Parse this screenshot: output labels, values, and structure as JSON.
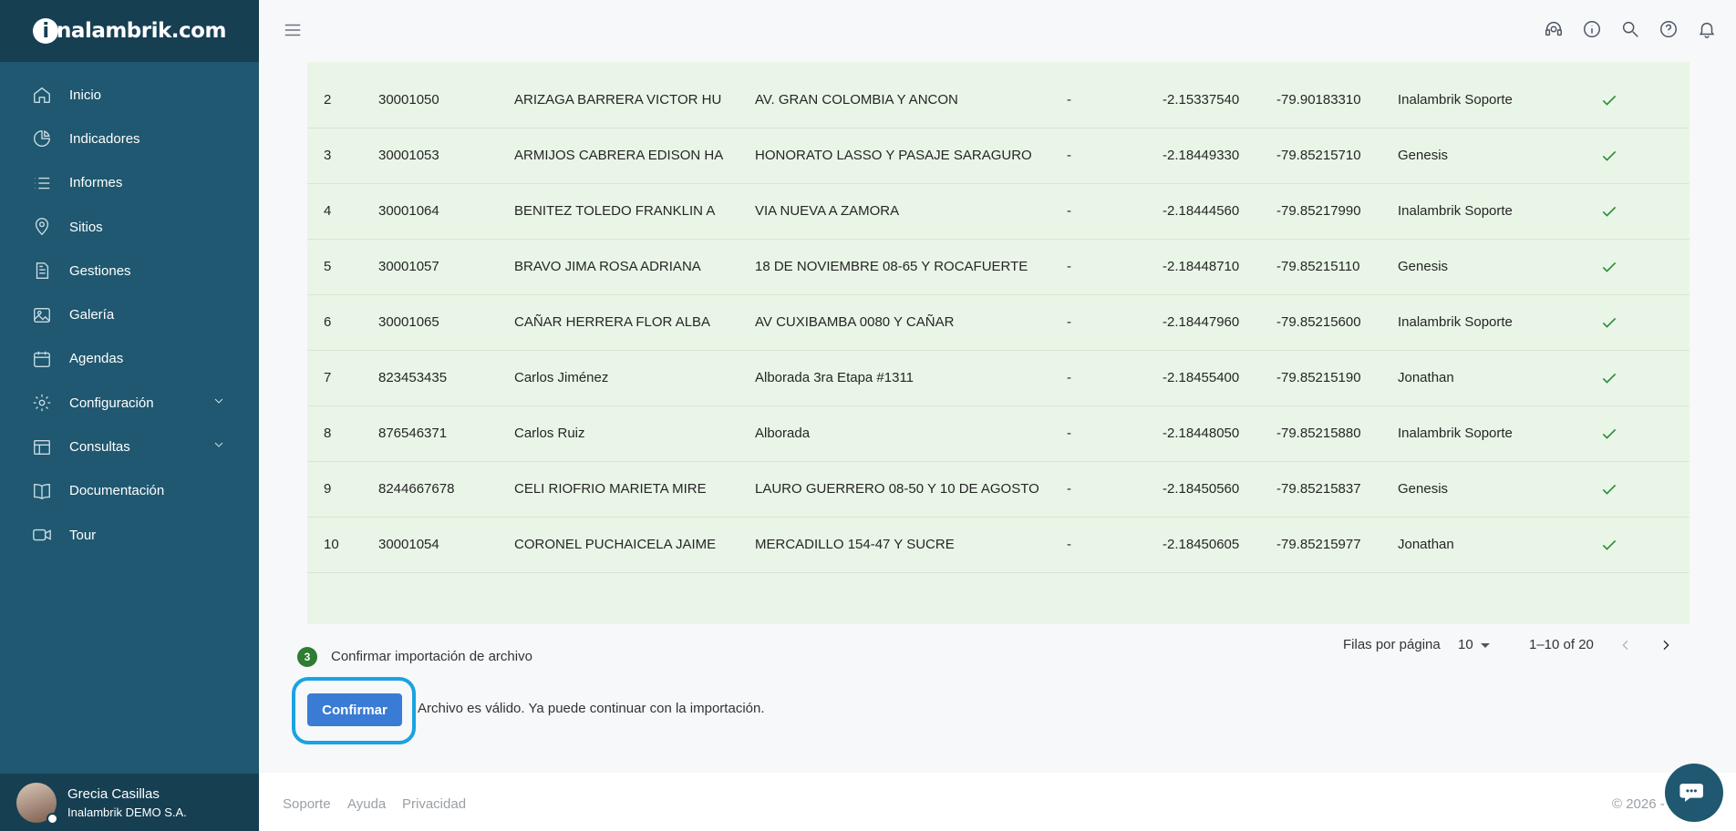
{
  "app": {
    "logo_text": "nalambrik.com",
    "logo_i": "i"
  },
  "sidebar": {
    "items": [
      {
        "label": "Inicio",
        "icon": "home-icon"
      },
      {
        "label": "Indicadores",
        "icon": "pie-chart-icon"
      },
      {
        "label": "Informes",
        "icon": "list-icon"
      },
      {
        "label": "Sitios",
        "icon": "map-pin-icon"
      },
      {
        "label": "Gestiones",
        "icon": "document-icon"
      },
      {
        "label": "Galería",
        "icon": "image-icon"
      },
      {
        "label": "Agendas",
        "icon": "calendar-icon"
      },
      {
        "label": "Configuración",
        "icon": "gear-icon",
        "chevron": true
      },
      {
        "label": "Consultas",
        "icon": "table-icon",
        "chevron": true
      },
      {
        "label": "Documentación",
        "icon": "book-icon"
      },
      {
        "label": "Tour",
        "icon": "video-icon"
      }
    ],
    "user": {
      "name": "Grecia Casillas",
      "company": "Inalambrik DEMO S.A."
    }
  },
  "topbar": {
    "icons": [
      "support-icon",
      "info-icon",
      "search-icon",
      "help-icon",
      "bell-icon"
    ]
  },
  "table": {
    "rows": [
      {
        "n": "2",
        "code": "30001050",
        "name": "ARIZAGA BARRERA VICTOR HU",
        "address": "AV. GRAN COLOMBIA Y ANCON",
        "ref": "-",
        "lat": "-2.15337540",
        "lon": "-79.90183310",
        "user": "Inalambrik Soporte"
      },
      {
        "n": "3",
        "code": "30001053",
        "name": "ARMIJOS CABRERA EDISON HA",
        "address": "HONORATO LASSO Y PASAJE SARAGURO",
        "ref": "-",
        "lat": "-2.18449330",
        "lon": "-79.85215710",
        "user": "Genesis"
      },
      {
        "n": "4",
        "code": "30001064",
        "name": "BENITEZ TOLEDO FRANKLIN A",
        "address": "VIA NUEVA A ZAMORA",
        "ref": "-",
        "lat": "-2.18444560",
        "lon": "-79.85217990",
        "user": "Inalambrik Soporte"
      },
      {
        "n": "5",
        "code": "30001057",
        "name": "BRAVO JIMA ROSA ADRIANA",
        "address": "18 DE NOVIEMBRE 08-65 Y ROCAFUERTE",
        "ref": "-",
        "lat": "-2.18448710",
        "lon": "-79.85215110",
        "user": "Genesis"
      },
      {
        "n": "6",
        "code": "30001065",
        "name": "CAÑAR HERRERA FLOR ALBA",
        "address": "AV CUXIBAMBA 0080 Y CAÑAR",
        "ref": "-",
        "lat": "-2.18447960",
        "lon": "-79.85215600",
        "user": "Inalambrik Soporte"
      },
      {
        "n": "7",
        "code": "823453435",
        "name": "Carlos Jiménez",
        "address": "Alborada 3ra Etapa #1311",
        "ref": "-",
        "lat": "-2.18455400",
        "lon": "-79.85215190",
        "user": "Jonathan"
      },
      {
        "n": "8",
        "code": "876546371",
        "name": "Carlos Ruiz",
        "address": "Alborada",
        "ref": "-",
        "lat": "-2.18448050",
        "lon": "-79.85215880",
        "user": "Inalambrik Soporte"
      },
      {
        "n": "9",
        "code": "8244667678",
        "name": "CELI RIOFRIO MARIETA MIRE",
        "address": "LAURO GUERRERO 08-50 Y 10 DE AGOSTO",
        "ref": "-",
        "lat": "-2.18450560",
        "lon": "-79.85215837",
        "user": "Genesis"
      },
      {
        "n": "10",
        "code": "30001054",
        "name": "CORONEL PUCHAICELA JAIME",
        "address": "MERCADILLO 154-47 Y SUCRE",
        "ref": "-",
        "lat": "-2.18450605",
        "lon": "-79.85215977",
        "user": "Jonathan"
      }
    ],
    "pager": {
      "rows_per_page_label": "Filas por página",
      "rows_per_page": "10",
      "range": "1–10 of 20"
    }
  },
  "step": {
    "number": "3",
    "label": "Confirmar importación de archivo",
    "button": "Confirmar",
    "message": "Archivo es válido. Ya puede continuar con la importación."
  },
  "footer": {
    "links": [
      "Soporte",
      "Ayuda",
      "Privacidad"
    ],
    "copyright": "© 2026 -"
  },
  "colors": {
    "sidebar": "#1f5870",
    "sidebar_dark": "#163f52",
    "table_bg": "#e9f6e7",
    "check": "#2e8b3a",
    "button": "#3a7bd5",
    "highlight_ring": "#1aa3e0",
    "step_badge": "#2e7d32"
  }
}
